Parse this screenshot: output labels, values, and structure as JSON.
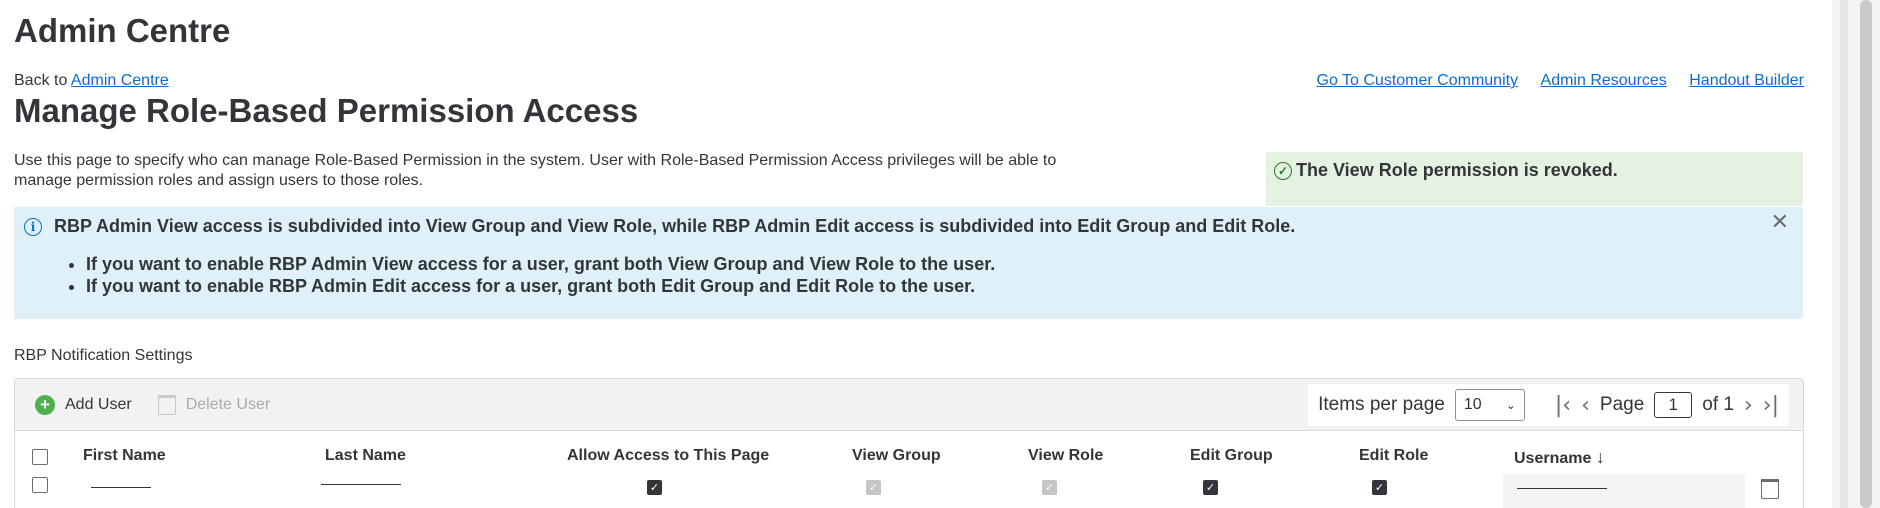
{
  "app": {
    "title": "Admin Centre"
  },
  "breadcrumb": {
    "prefix": "Back to ",
    "link": "Admin Centre"
  },
  "top_links": [
    "Go To Customer Community",
    "Admin Resources",
    "Handout Builder"
  ],
  "page": {
    "title": "Manage Role-Based Permission Access",
    "description": "Use this page to specify who can manage Role-Based Permission in the system. User with Role-Based Permission Access privileges will be able to manage permission roles and assign users to those roles."
  },
  "toast": {
    "message": "The View Role permission is revoked.",
    "color": "#e5f1e1"
  },
  "info": {
    "heading": "RBP Admin View access is subdivided into View Group and View Role, while RBP Admin Edit access is subdivided into Edit Group and Edit Role.",
    "bullets": [
      "If you want to enable RBP Admin View access for a user, grant both View Group and View Role to the user.",
      "If you want to enable RBP Admin Edit access for a user, grant both Edit Group and Edit Role to the user."
    ],
    "close_icon": "close-icon",
    "color": "#dff0f9"
  },
  "section": {
    "label": "RBP Notification Settings"
  },
  "toolbar": {
    "add_label": "Add User",
    "delete_label": "Delete User",
    "items_per_page_label": "Items per page",
    "items_per_page_value": "10",
    "page_label": "Page",
    "page_value": "1",
    "of_label": "of 1"
  },
  "table": {
    "columns": [
      "First Name",
      "Last Name",
      "Allow Access to This Page",
      "View Group",
      "View Role",
      "Edit Group",
      "Edit Role",
      "Username"
    ],
    "sort_icon": "arrow-down-icon",
    "rows": [
      {
        "allow_access": true,
        "view_group": true,
        "view_role": true,
        "edit_group": true,
        "edit_role": true
      }
    ]
  }
}
